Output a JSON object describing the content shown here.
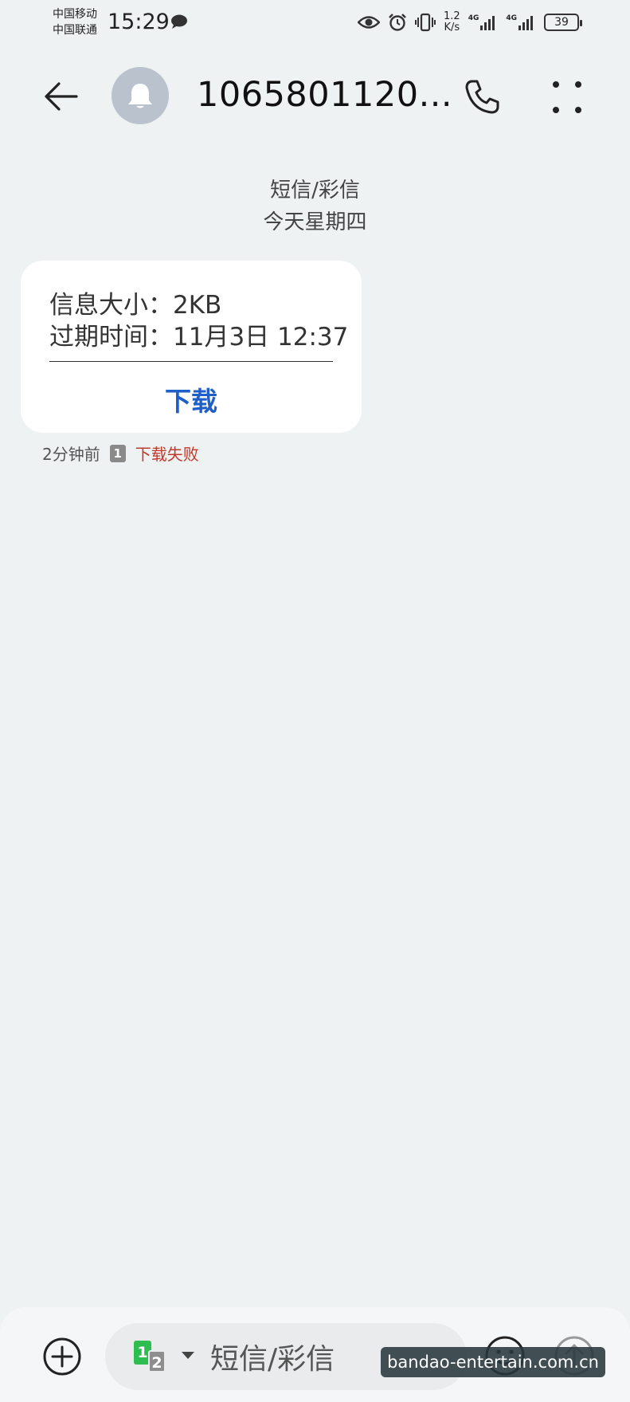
{
  "status_bar": {
    "carrier_1": "中国移动",
    "carrier_2": "中国联通",
    "time": "15:29",
    "speed_value": "1.2",
    "speed_unit": "K/s",
    "network_1": "4G",
    "network_2": "4G",
    "battery": "39"
  },
  "header": {
    "title": "1065801120...",
    "avatar_icon": "bell-icon",
    "back_icon": "arrow-left-icon",
    "call_icon": "phone-icon",
    "more_icon": "more-dots-icon"
  },
  "conversation": {
    "type_label": "短信/彩信",
    "date_label": "今天星期四"
  },
  "message": {
    "size_line": "信息大小：2KB",
    "expiry_line": "过期时间：11月3日 12:37",
    "download_label": "下载",
    "time_ago": "2分钟前",
    "sim_slot": "1",
    "status": "下载失败",
    "status_color": "#c0392b"
  },
  "composer": {
    "sim_1": "1",
    "sim_2": "2",
    "placeholder": "短信/彩信",
    "add_icon": "plus-circle-icon",
    "emoji_icon": "smiley-icon",
    "send_icon": "send-arrow-icon"
  },
  "watermark": "bandao-entertain.com.cn",
  "colors": {
    "accent": "#1f5fc7",
    "background": "#eef2f3",
    "sim_green": "#2ebd4f"
  }
}
